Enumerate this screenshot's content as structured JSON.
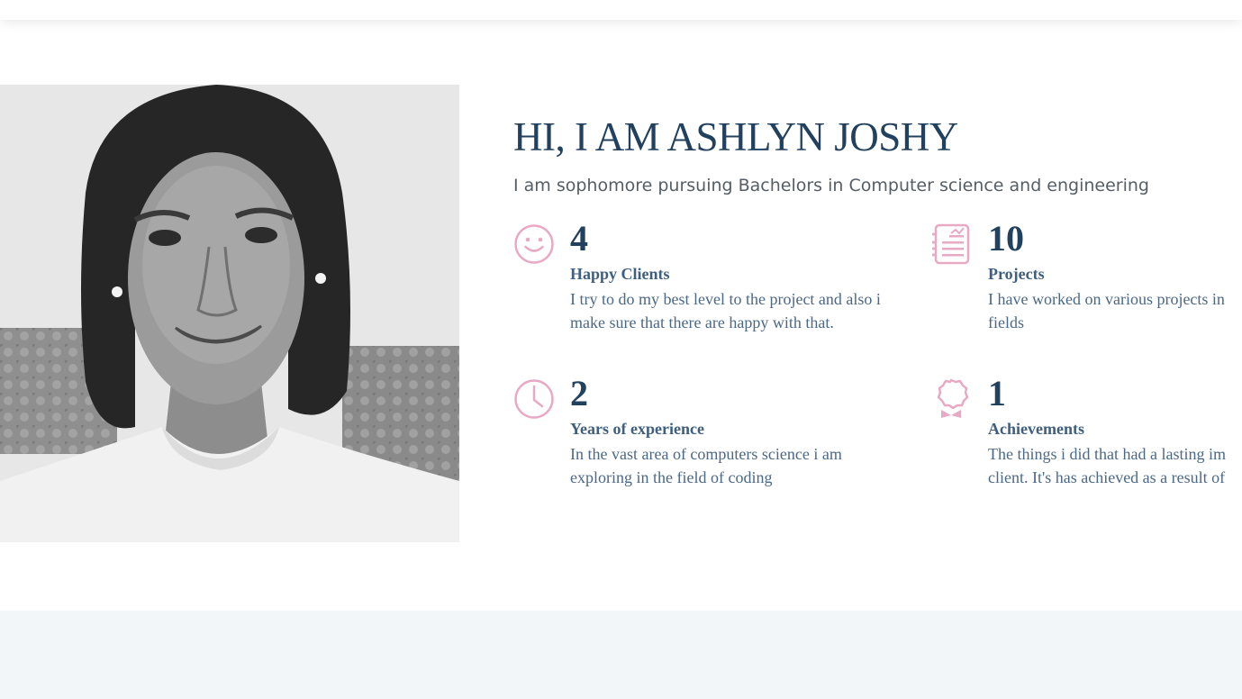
{
  "about": {
    "title": "HI, I AM ASHLYN JOSHY",
    "subtitle": "I am sophomore pursuing Bachelors in Computer science and engineering",
    "photo_alt": "Portrait photo of Ashlyn Joshy",
    "stats": [
      {
        "icon": "smile-icon",
        "number": "4",
        "label": "Happy Clients",
        "desc_line1": "I try to do my best level to the project and also i",
        "desc_line2": "make sure that there are happy with that."
      },
      {
        "icon": "document-chart-icon",
        "number": "10",
        "label": "Projects",
        "desc_line1": "I have worked on various projects in",
        "desc_line2": "fields"
      },
      {
        "icon": "clock-icon",
        "number": "2",
        "label": "Years of experience",
        "desc_line1": "In the vast area of computers science i am",
        "desc_line2": "exploring in the field of coding"
      },
      {
        "icon": "award-icon",
        "number": "1",
        "label": "Achievements",
        "desc_line1": "The things i did that had a lasting im",
        "desc_line2": "client. It's has achieved as a result of"
      }
    ]
  },
  "colors": {
    "heading": "#22415f",
    "label": "#3f5f80",
    "icon_accent": "#e8a9c4",
    "footer_bg": "#f3f6f9"
  }
}
